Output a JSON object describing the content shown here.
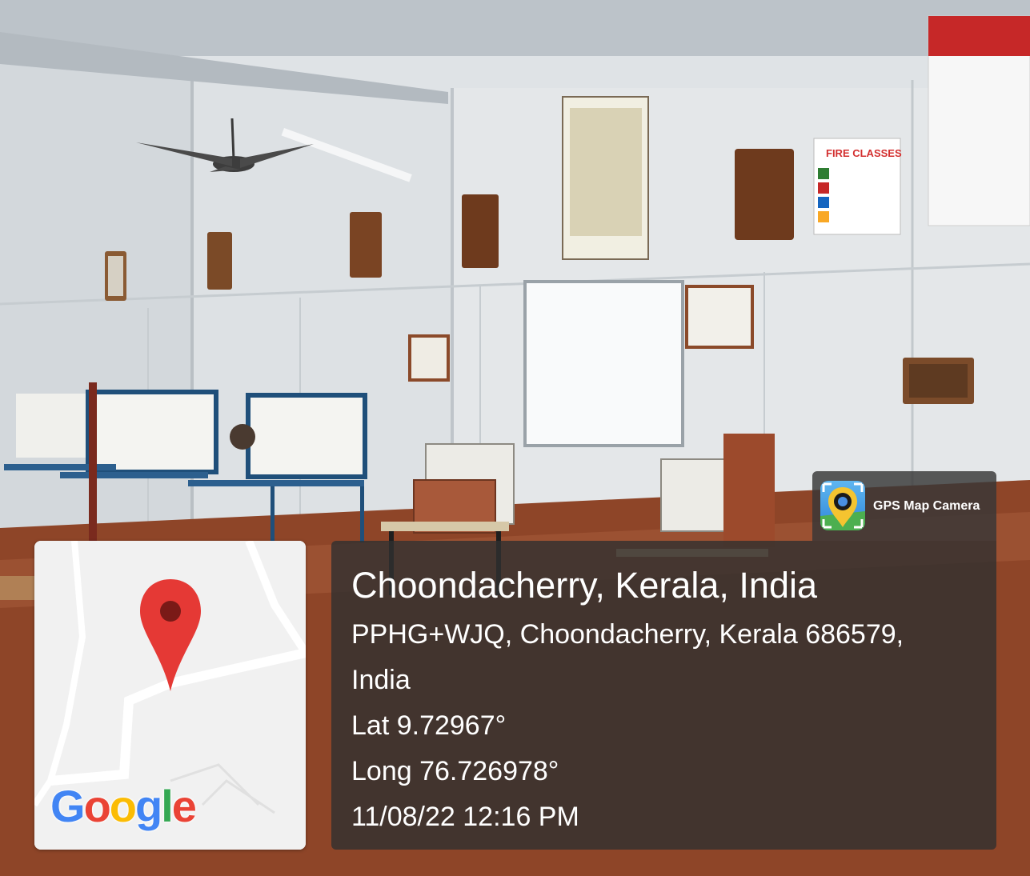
{
  "overlay": {
    "app_name": "GPS Map Camera",
    "location_title": "Choondacherry, Kerala, India",
    "address_line1": "PPHG+WJQ, Choondacherry, Kerala 686579,",
    "address_line2": "India",
    "latitude": "Lat 9.72967°",
    "longitude": "Long 76.726978°",
    "datetime": "11/08/22 12:16 PM"
  },
  "map": {
    "logo_letters": [
      "G",
      "o",
      "o",
      "g",
      "l",
      "e"
    ],
    "logo_colors": [
      "#4285F4",
      "#EA4335",
      "#FBBC05",
      "#4285F4",
      "#34A853",
      "#EA4335"
    ],
    "pin_color": "#E53935"
  },
  "scene": {
    "poster_heading": "FIRE CLASSES"
  },
  "colors": {
    "panel_bg": "#303030",
    "text": "#ffffff"
  }
}
